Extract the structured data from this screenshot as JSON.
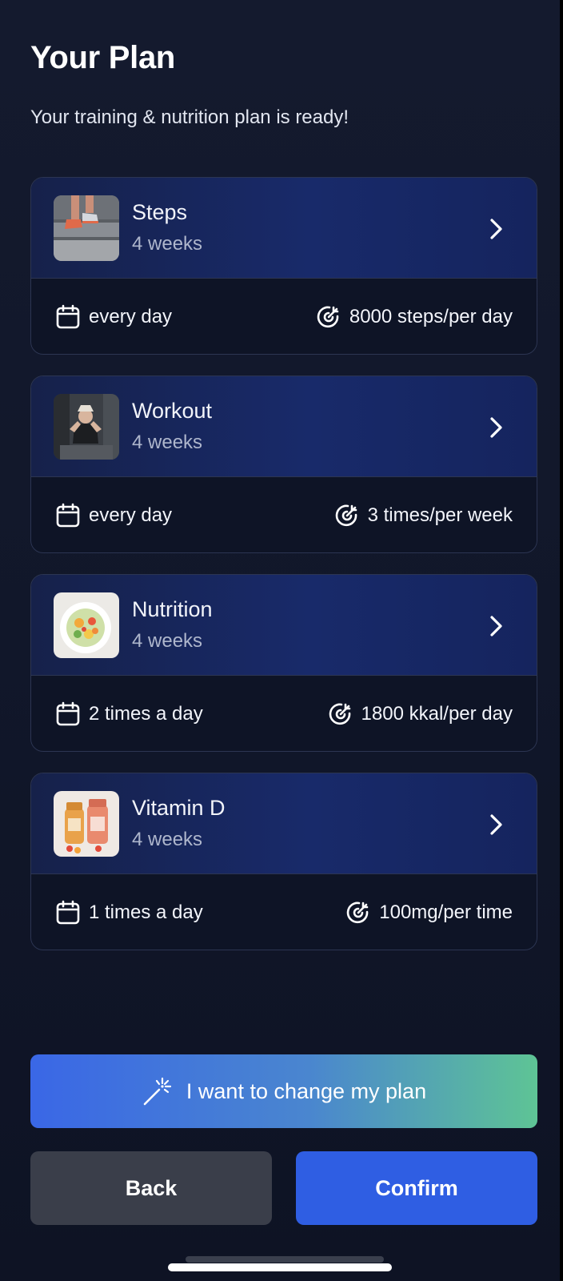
{
  "header": {
    "title": "Your Plan",
    "subtitle": "Your training & nutrition plan is ready!"
  },
  "plans": [
    {
      "name": "Steps",
      "duration": "4 weeks",
      "frequency": "every day",
      "goal": "8000 steps/per day",
      "image_icon": "running-shoes-photo"
    },
    {
      "name": "Workout",
      "duration": "4 weeks",
      "frequency": "every day",
      "goal": "3 times/per week",
      "image_icon": "workout-photo"
    },
    {
      "name": "Nutrition",
      "duration": "4 weeks",
      "frequency": "2 times a day",
      "goal": "1800 kkal/per day",
      "image_icon": "salad-photo"
    },
    {
      "name": "Vitamin D",
      "duration": "4 weeks",
      "frequency": "1 times a day",
      "goal": "100mg/per time",
      "image_icon": "vitamin-bottles-photo"
    }
  ],
  "actions": {
    "change_label": "I want to change my plan",
    "back_label": "Back",
    "confirm_label": "Confirm"
  },
  "colors": {
    "background": "#131a2d",
    "card_header": "#182a6a",
    "confirm": "#2f5ee3",
    "back": "#3a3e4a",
    "gradient_start": "#3a67e6",
    "gradient_end": "#5ec495"
  }
}
